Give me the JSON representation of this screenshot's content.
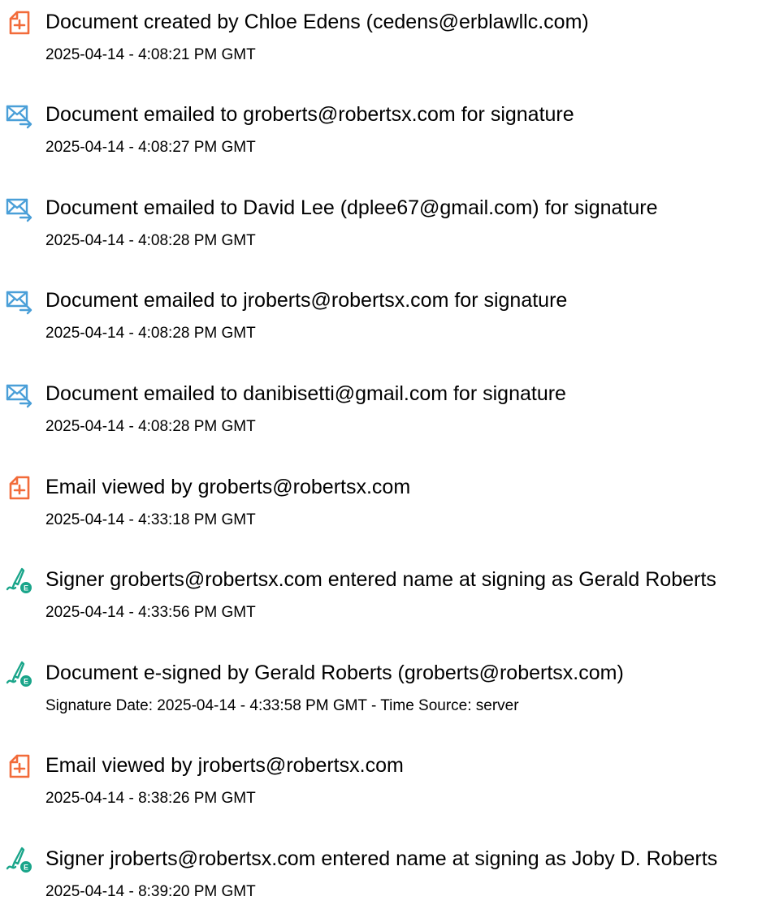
{
  "events": [
    {
      "icon": "document-created-icon",
      "title": "Document created by Chloe Edens (cedens@erblawllc.com)",
      "time": "2025-04-14 - 4:08:21 PM GMT"
    },
    {
      "icon": "email-sent-icon",
      "title": "Document emailed to groberts@robertsx.com for signature",
      "time": "2025-04-14 - 4:08:27 PM GMT"
    },
    {
      "icon": "email-sent-icon",
      "title": "Document emailed to David Lee (dplee67@gmail.com) for signature",
      "time": "2025-04-14 - 4:08:28 PM GMT"
    },
    {
      "icon": "email-sent-icon",
      "title": "Document emailed to jroberts@robertsx.com for signature",
      "time": "2025-04-14 - 4:08:28 PM GMT"
    },
    {
      "icon": "email-sent-icon",
      "title": "Document emailed to danibisetti@gmail.com for signature",
      "time": "2025-04-14 - 4:08:28 PM GMT"
    },
    {
      "icon": "email-viewed-icon",
      "title": "Email viewed by groberts@robertsx.com",
      "time": "2025-04-14 - 4:33:18 PM GMT"
    },
    {
      "icon": "e-sign-icon",
      "title": "Signer groberts@robertsx.com entered name at signing as Gerald Roberts",
      "time": "2025-04-14 - 4:33:56 PM GMT"
    },
    {
      "icon": "e-sign-icon",
      "title": "Document e-signed by Gerald Roberts (groberts@robertsx.com)",
      "time": "Signature Date: 2025-04-14 - 4:33:58 PM GMT - Time Source: server"
    },
    {
      "icon": "email-viewed-icon",
      "title": "Email viewed by jroberts@robertsx.com",
      "time": "2025-04-14 - 8:38:26 PM GMT"
    },
    {
      "icon": "e-sign-icon",
      "title": "Signer jroberts@robertsx.com entered name at signing as Joby D. Roberts",
      "time": "2025-04-14 - 8:39:20 PM GMT"
    }
  ],
  "colors": {
    "document_icon": "#f26b3a",
    "email_icon": "#4a9fd8",
    "sign_icon": "#1aa58a"
  }
}
